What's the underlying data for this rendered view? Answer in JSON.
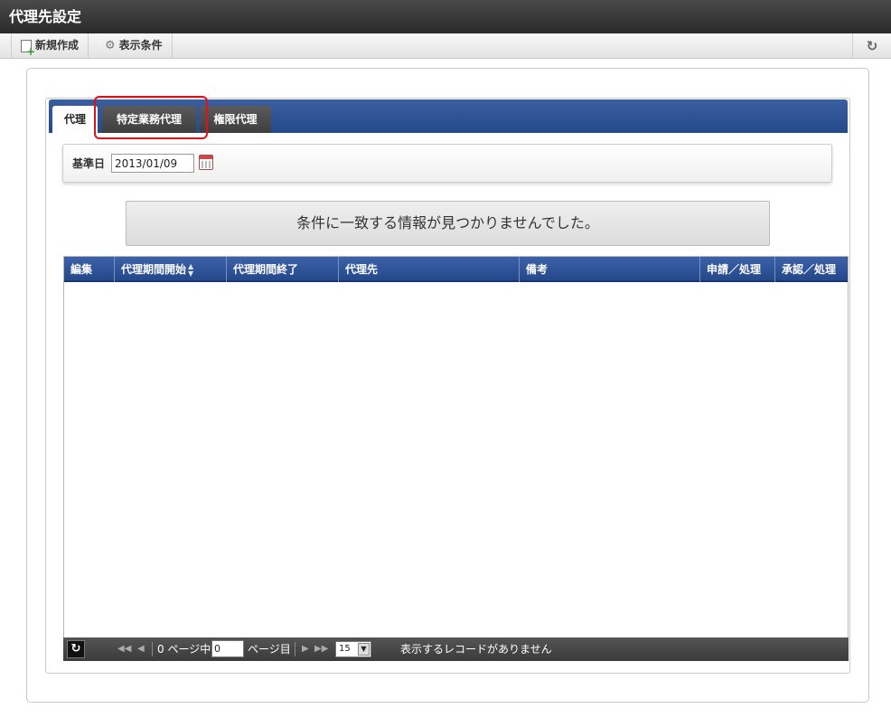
{
  "window": {
    "title": "代理先設定"
  },
  "toolbar": {
    "new_label": "新規作成",
    "new_icon": "new-document-icon",
    "conditions_label": "表示条件",
    "conditions_icon": "gear-icon",
    "refresh_icon": "refresh-icon",
    "refresh_glyph": "↻"
  },
  "tabs": [
    {
      "label": "代理",
      "active": true
    },
    {
      "label": "特定業務代理",
      "active": false,
      "highlighted": true
    },
    {
      "label": "権限代理",
      "active": false
    }
  ],
  "search": {
    "label": "基準日",
    "date_value": "2013/01/09",
    "calendar_icon": "calendar-icon"
  },
  "message": "条件に一致する情報が見つかりませんでした。",
  "grid": {
    "columns": [
      "編集",
      "代理期間開始",
      "代理期間終了",
      "代理先",
      "備考",
      "申請／処理",
      "承認／処理"
    ],
    "sorted_column": "代理期間開始",
    "rows": []
  },
  "pager": {
    "refresh_glyph": "↻",
    "first_glyph": "◀◀",
    "prev_glyph": "◀",
    "next_glyph": "▶",
    "last_glyph": "▶▶",
    "page_prefix": "0 ページ中",
    "page_value": "0",
    "page_suffix": "ページ目",
    "rows_per_page": "15",
    "status": "表示するレコードがありません"
  },
  "colors": {
    "header_blue": "#2b4f92",
    "highlight_red": "#d9141a",
    "title_bar": "#333333"
  }
}
